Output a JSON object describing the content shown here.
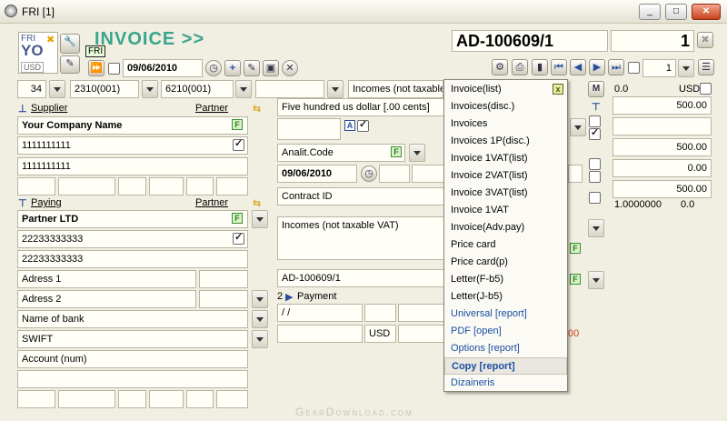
{
  "window": {
    "title": "FRI [1]",
    "min": "_",
    "max": "□",
    "close": "✕"
  },
  "header": {
    "logo_top": "FRI",
    "logo_main": "YO",
    "logo_tag": "FRI",
    "currency": "USD",
    "doc_type": "INVOICE >>",
    "doc_number": "AD-100609/1",
    "copy_count": "1",
    "date": "09/06/2010",
    "page_value": "1"
  },
  "row2": {
    "f1": "34",
    "f2": "2310(001)",
    "f3": "6210(001)",
    "f4": "",
    "f5": "Incomes (not taxable"
  },
  "supplier": {
    "label": "Supplier",
    "partner": "Partner",
    "name": "Your Company Name",
    "code1": "1111111111",
    "code2": "1111111111"
  },
  "paying": {
    "label": "Paying",
    "partner": "Partner",
    "name": "Partner LTD",
    "code1": "22233333333",
    "code2": "22233333333",
    "addr1": "Adress 1",
    "addr2": "Adress 2",
    "bank": "Name of bank",
    "swift": "SWIFT",
    "account": "Account (num)"
  },
  "middle": {
    "words": "Five hundred us dollar [.00 cents]",
    "analit": "Analit.Code",
    "date": "09/06/2010",
    "contract": "Contract ID",
    "note": "Incomes (not taxable VAT)",
    "ref": "AD-100609/1",
    "pay_num": "2",
    "payment": "Payment",
    "slashes": "/ /",
    "currency": "USD",
    "red_tail": "00"
  },
  "right": {
    "m_label": "M",
    "v0": "0.0",
    "cur": "USD",
    "a1": "500.00",
    "a2": "",
    "a3": "500.00",
    "a4": "0.00",
    "a5": "500.00",
    "rate": "1.0000000",
    "rate2": "0.0"
  },
  "menu": {
    "close": "x",
    "items": [
      {
        "label": "Invoice(list)",
        "style": "normal"
      },
      {
        "label": "Invoices(disc.)",
        "style": "normal"
      },
      {
        "label": "Invoices",
        "style": "normal"
      },
      {
        "label": "Invoices 1P(disc.)",
        "style": "normal"
      },
      {
        "label": "Invoice 1VAT(list)",
        "style": "normal"
      },
      {
        "label": "Invoice 2VAT(list)",
        "style": "normal"
      },
      {
        "label": "Invoice 3VAT(list)",
        "style": "normal"
      },
      {
        "label": "Invoice 1VAT",
        "style": "normal"
      },
      {
        "label": "Invoice(Adv.pay)",
        "style": "normal"
      },
      {
        "label": "Price card",
        "style": "normal"
      },
      {
        "label": "Price card(p)",
        "style": "normal"
      },
      {
        "label": "Letter(F-b5)",
        "style": "normal"
      },
      {
        "label": "Letter(J-b5)",
        "style": "normal"
      },
      {
        "label": "Universal [report]",
        "style": "blue"
      },
      {
        "label": "PDF [open]",
        "style": "blue"
      },
      {
        "label": "Options [report]",
        "style": "blue"
      },
      {
        "label": "Copy [report]",
        "style": "sel"
      },
      {
        "label": "Dizaineris",
        "style": "blue"
      }
    ]
  },
  "watermark": "GearDownload.com"
}
